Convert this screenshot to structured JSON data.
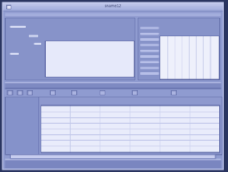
{
  "window": {
    "title": "sname12"
  },
  "colors": {
    "window_bg": "#8f9bd0",
    "panel_bg": "#e6e9fa",
    "outer_bg": "#2a3560"
  },
  "icons": {
    "close": "close-icon"
  }
}
